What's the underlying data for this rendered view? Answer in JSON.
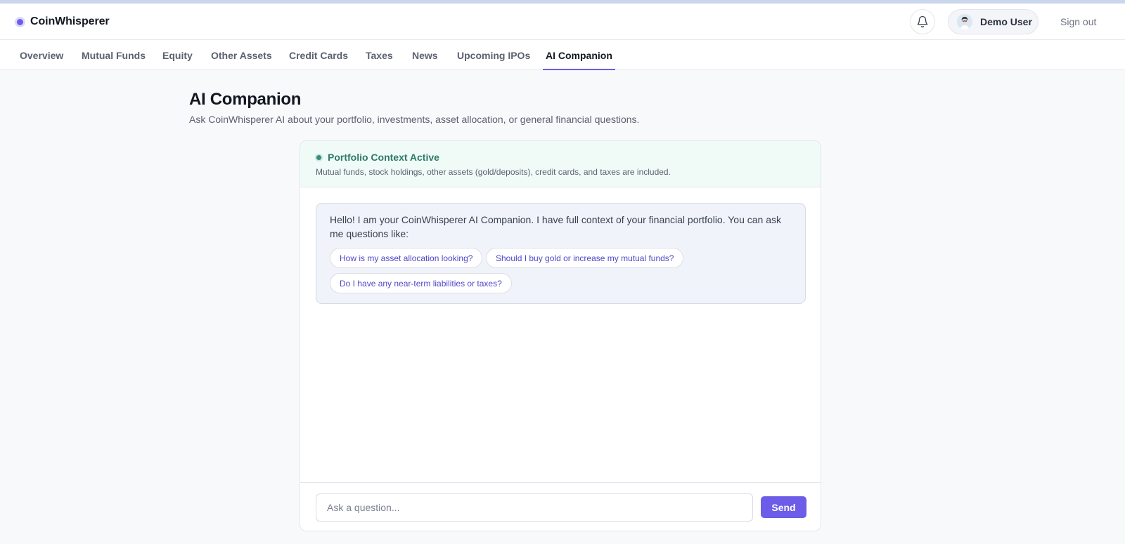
{
  "app": {
    "name": "CoinWhisperer"
  },
  "header": {
    "user_name": "Demo User",
    "sign_out_label": "Sign out"
  },
  "nav": {
    "tabs": [
      {
        "label": "Overview",
        "active": false
      },
      {
        "label": "Mutual Funds",
        "active": false
      },
      {
        "label": "Equity",
        "active": false
      },
      {
        "label": "Other Assets",
        "active": false
      },
      {
        "label": "Credit Cards",
        "active": false
      },
      {
        "label": "Taxes",
        "active": false
      },
      {
        "label": "News",
        "active": false
      },
      {
        "label": "Upcoming IPOs",
        "active": false
      },
      {
        "label": "AI Companion",
        "active": true
      }
    ]
  },
  "page": {
    "title": "AI Companion",
    "subtitle": "Ask CoinWhisperer AI about your portfolio, investments, asset allocation, or general financial questions."
  },
  "context": {
    "title": "Portfolio Context Active",
    "description": "Mutual funds, stock holdings, other assets (gold/deposits), credit cards, and taxes are included."
  },
  "chat": {
    "greeting": "Hello! I am your CoinWhisperer AI Companion. I have full context of your financial portfolio. You can ask me questions like:",
    "suggestions": [
      "How is my asset allocation looking?",
      "Should I buy gold or increase my mutual funds?",
      "Do I have any near-term liabilities or taxes?"
    ]
  },
  "composer": {
    "placeholder": "Ask a question...",
    "value": "",
    "send_label": "Send"
  },
  "colors": {
    "accent": "#6c5ce7",
    "context_green": "#2f7a68",
    "context_bg": "#f0fbf8",
    "suggestion_text": "#4f46c8"
  },
  "icons": {
    "brand": "brand-dot-icon",
    "notifications": "bell-icon",
    "avatar": "user-avatar-icon",
    "context_status": "status-dot-icon"
  }
}
